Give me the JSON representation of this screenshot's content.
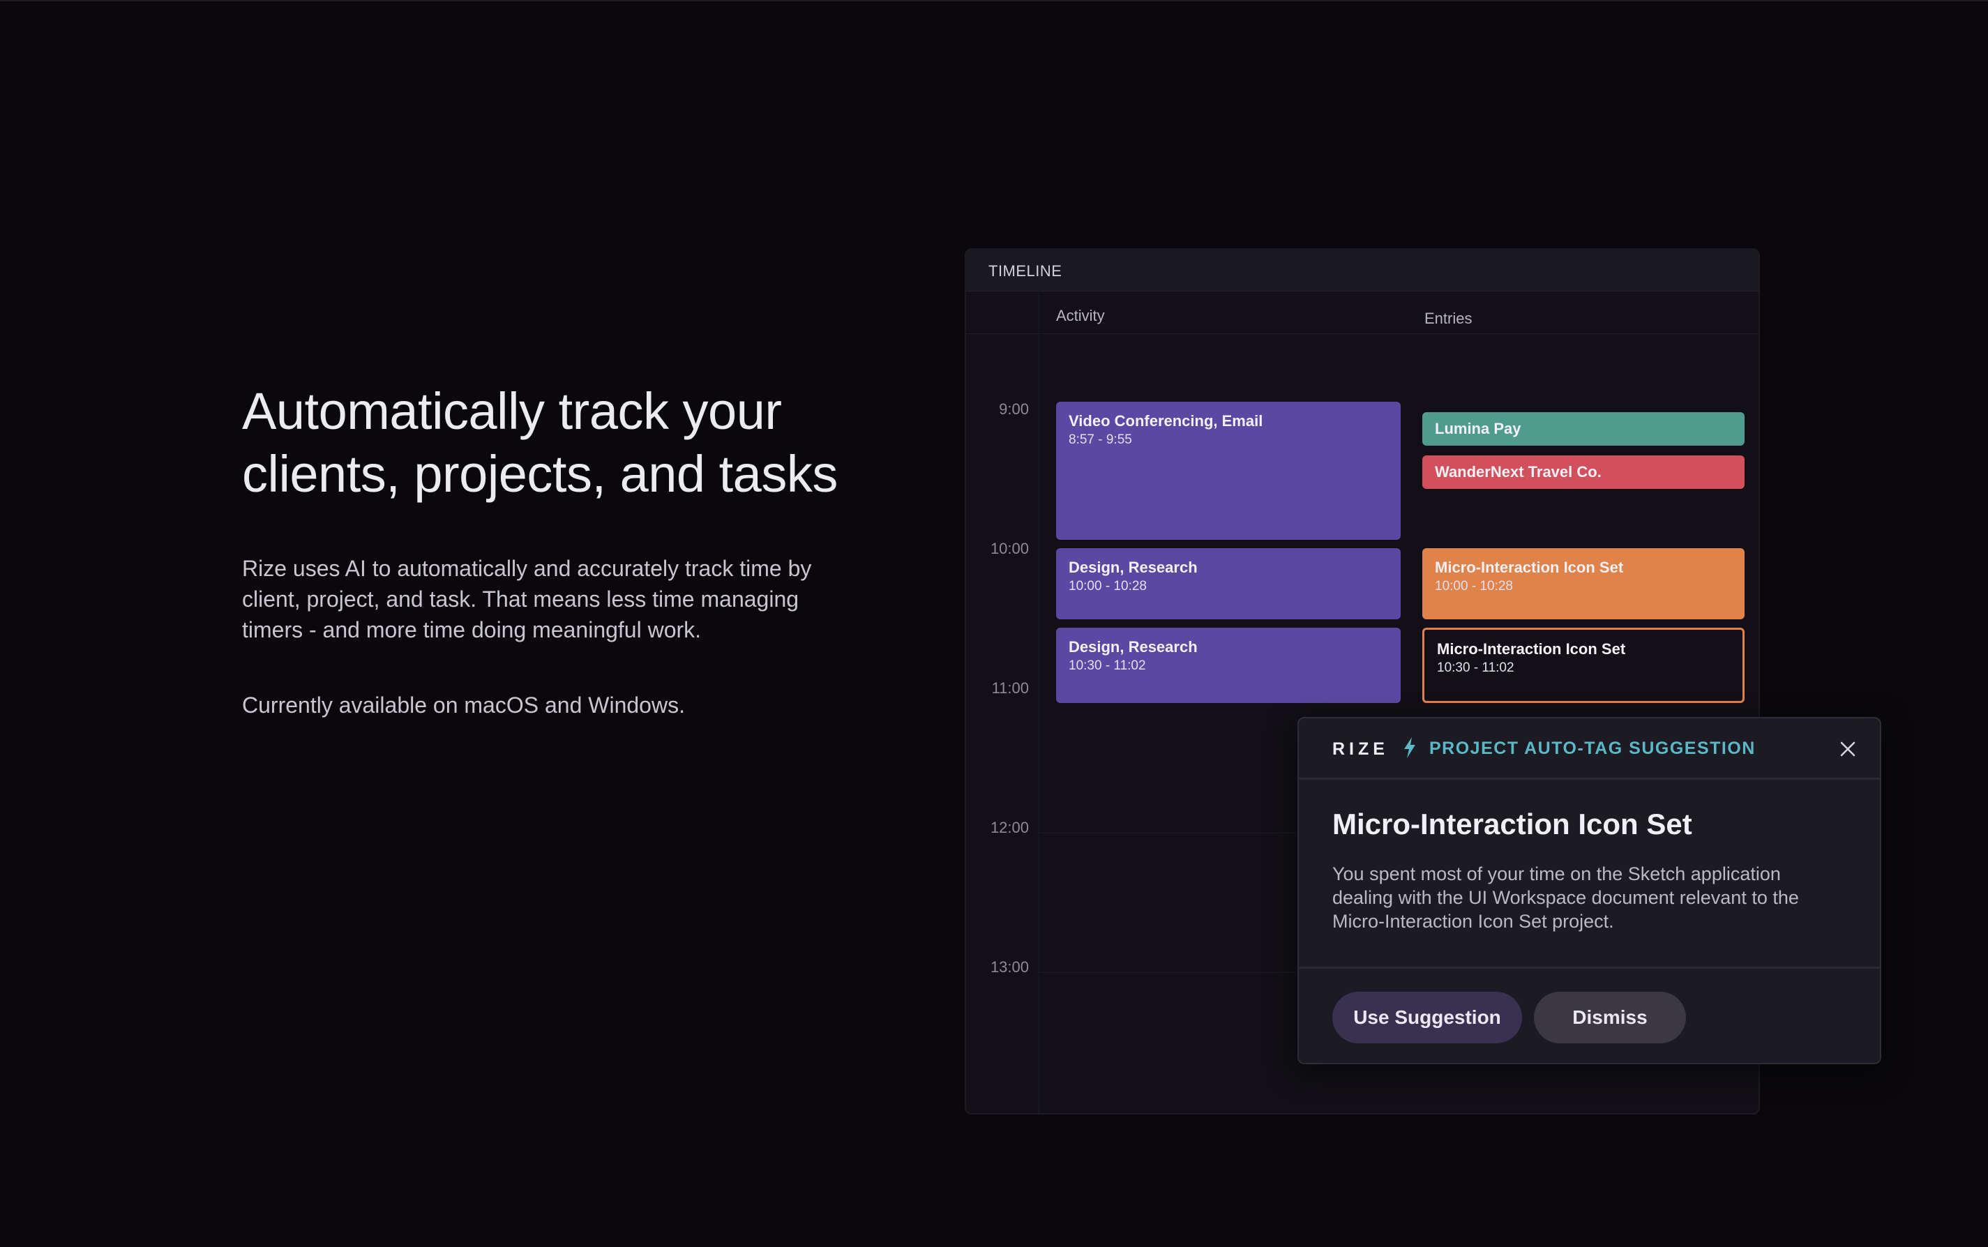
{
  "hero": {
    "title": "Automatically track your clients, projects, and tasks",
    "description": "Rize uses AI to automatically and accurately track time by client, project, and task. That means less time managing timers - and more time doing meaningful work.",
    "availability": "Currently available on macOS and Windows."
  },
  "timeline": {
    "title": "TIMELINE",
    "columns": {
      "activity": "Activity",
      "entries": "Entries"
    },
    "hours": [
      "9:00",
      "10:00",
      "11:00",
      "12:00",
      "13:00"
    ],
    "activities": [
      {
        "title": "Video Conferencing, Email",
        "time": "8:57 - 9:55",
        "color": "#5b48a2"
      },
      {
        "title": "Design, Research",
        "time": "10:00 - 10:28",
        "color": "#5b48a2"
      },
      {
        "title": "Design, Research",
        "time": "10:30 - 11:02",
        "color": "#5b48a2"
      }
    ],
    "entries": [
      {
        "title": "Lumina Pay",
        "color": "#4f9c8e"
      },
      {
        "title": "WanderNext Travel Co.",
        "color": "#d24f5c"
      },
      {
        "title": "Micro-Interaction Icon Set",
        "time": "10:00 - 10:28",
        "color": "#e0834a"
      },
      {
        "title": "Micro-Interaction Icon Set",
        "time": "10:30 - 11:02",
        "color": "#e0834a"
      }
    ]
  },
  "popup": {
    "brand": "RIZE",
    "label": "PROJECT AUTO-TAG SUGGESTION",
    "title": "Micro-Interaction Icon Set",
    "body": "You spent most of your time on the Sketch application dealing with the UI Workspace document relevant to the Micro-Interaction Icon Set project.",
    "use_label": "Use Suggestion",
    "dismiss_label": "Dismiss",
    "accent": "#5bb8c6"
  }
}
